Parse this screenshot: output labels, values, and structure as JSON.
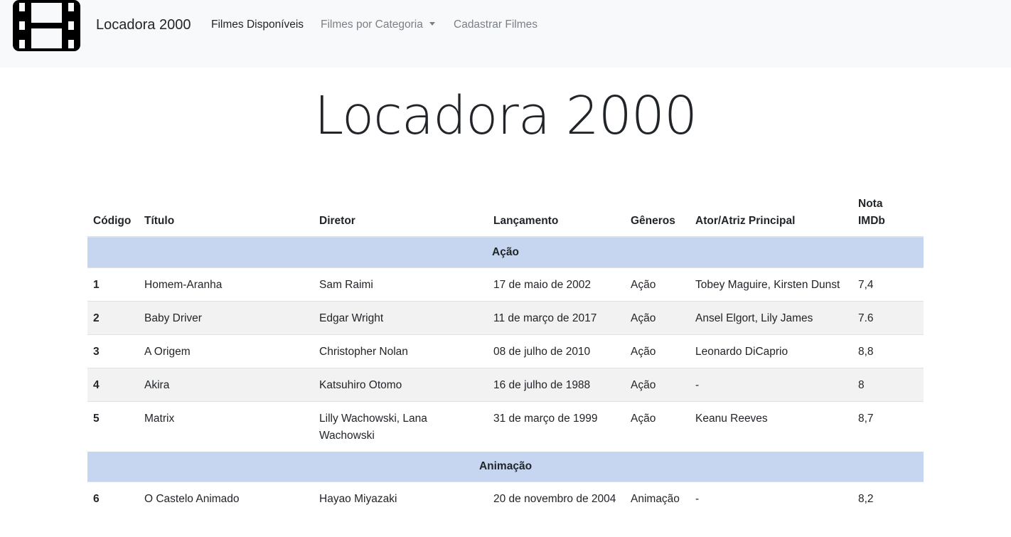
{
  "navbar": {
    "logo_icon": "film-icon",
    "brand": "Locadora 2000",
    "links": [
      {
        "label": "Filmes Disponíveis"
      },
      {
        "label": "Filmes por Categoria"
      },
      {
        "label": "Cadastrar Filmes"
      }
    ]
  },
  "page_title": "Locadora 2000",
  "table": {
    "headers": [
      "Código",
      "Título",
      "Diretor",
      "Lançamento",
      "Gêneros",
      "Ator/Atriz Principal",
      "Nota",
      "IMDb"
    ],
    "categories": [
      {
        "name": "Ação",
        "rows": [
          {
            "code": "1",
            "title": "Homem-Aranha",
            "director": "Sam Raimi",
            "release": "17 de maio de 2002",
            "genre": "Ação",
            "actors": "Tobey Maguire, Kirsten Dunst",
            "rating": "7,4"
          },
          {
            "code": "2",
            "title": "Baby Driver",
            "director": "Edgar Wright",
            "release": "11 de março de 2017",
            "genre": "Ação",
            "actors": "Ansel Elgort, Lily James",
            "rating": "7.6"
          },
          {
            "code": "3",
            "title": "A Origem",
            "director": "Christopher Nolan",
            "release": "08 de julho de 2010",
            "genre": "Ação",
            "actors": "Leonardo DiCaprio",
            "rating": "8,8"
          },
          {
            "code": "4",
            "title": "Akira",
            "director": "Katsuhiro Otomo",
            "release": "16 de julho de 1988",
            "genre": "Ação",
            "actors": "-",
            "rating": "8"
          },
          {
            "code": "5",
            "title": "Matrix",
            "director": "Lilly Wachowski, Lana Wachowski",
            "release": "31 de março de 1999",
            "genre": "Ação",
            "actors": "Keanu Reeves",
            "rating": "8,7"
          }
        ]
      },
      {
        "name": "Animação",
        "rows": [
          {
            "code": "6",
            "title": "O Castelo Animado",
            "director": "Hayao Miyazaki",
            "release": "20 de novembro de 2004",
            "genre": "Animação",
            "actors": "-",
            "rating": "8,2"
          }
        ]
      }
    ]
  },
  "colors": {
    "navbar_bg": "#f8f9fa",
    "category_row_bg": "#c6d5f0",
    "striped_row_bg": "#f2f2f2"
  }
}
